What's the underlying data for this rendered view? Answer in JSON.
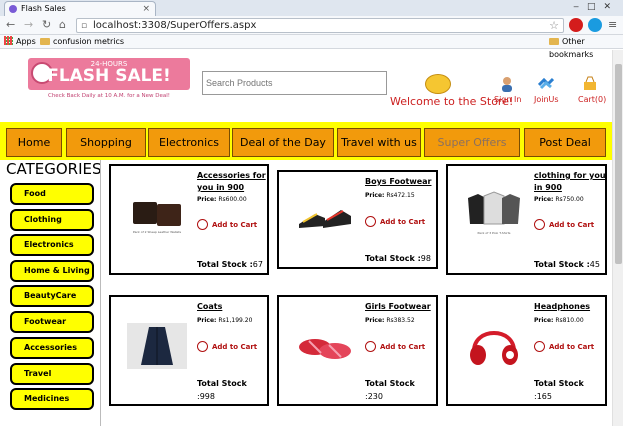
{
  "browser": {
    "tab_title": "Flash Sales",
    "url": "localhost:3308/SuperOffers.aspx",
    "bookmarks": [
      "Apps",
      "confusion metrics"
    ],
    "other_bookmarks": "Other bookmarks"
  },
  "header": {
    "logo_top": "24-HOURS",
    "logo_main": "FLASH SALE!",
    "tagline": "Check Back Daily at 10 A.M. for a New Deal!",
    "search_placeholder": "Search Products",
    "welcome": "Welcome to the Store!",
    "sign_in": "Sign In",
    "join_us": "JoinUs",
    "cart": "Cart(0)"
  },
  "menu": [
    "Home",
    "Shopping",
    "Electronics",
    "Deal of the Day",
    "Travel with us",
    "Super Offers",
    "Post Deal"
  ],
  "categories": {
    "title": "CATEGORIES",
    "items": [
      "Food",
      "Clothing",
      "Electronics",
      "Home & Living",
      "BeautyCare",
      "Footwear",
      "Accessories",
      "Travel",
      "Medicines"
    ]
  },
  "products": [
    {
      "name": "Accessories for you in 900",
      "price_label": "Price:",
      "price": "Rs600.00",
      "add": "Add to Cart",
      "stock_label": "Total Stock :",
      "stock": "67",
      "img_caption": "Pack of 2 Sheep Leather Wallets"
    },
    {
      "name": "Boys Footwear",
      "price_label": "Price:",
      "price": "Rs472.15",
      "add": "Add to Cart",
      "stock_label": "Total Stock :",
      "stock": "98"
    },
    {
      "name": "clothing for you in 900",
      "price_label": "Price:",
      "price": "Rs750.00",
      "add": "Add to Cart",
      "stock_label": "Total Stock :",
      "stock": "45",
      "img_caption": "Pack of 3 Polo T-Shirts"
    },
    {
      "name": "Coats",
      "price_label": "Price:",
      "price": "Rs1,199.20",
      "add": "Add to Cart",
      "stock_label": "Total Stock",
      "stock": ":998"
    },
    {
      "name": "Girls Footwear",
      "price_label": "Price:",
      "price": "Rs383.52",
      "add": "Add to Cart",
      "stock_label": "Total Stock",
      "stock": ":230"
    },
    {
      "name": "Headphones",
      "price_label": "Price:",
      "price": "Rs810.00",
      "add": "Add to Cart",
      "stock_label": "Total Stock",
      "stock": ":165"
    }
  ]
}
